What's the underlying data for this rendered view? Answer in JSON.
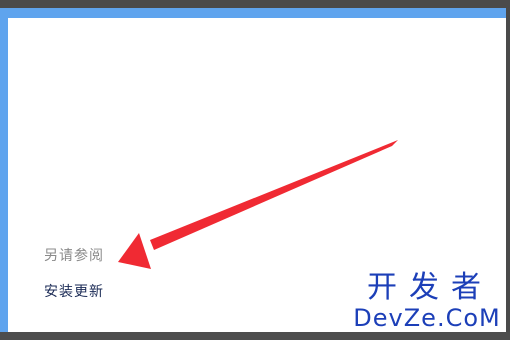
{
  "see_also": {
    "heading": "另请参阅",
    "link_install_updates": "安装更新"
  },
  "watermark": {
    "chinese": "开发者",
    "english": "DevZe.CoM"
  },
  "colors": {
    "window_border": "#5fa4ee",
    "arrow": "#f02a33",
    "link_text": "#1a2a55",
    "heading_text": "#8a8a8a",
    "watermark": "#1c3fb8"
  },
  "icons": [
    "red-annotation-arrow"
  ]
}
